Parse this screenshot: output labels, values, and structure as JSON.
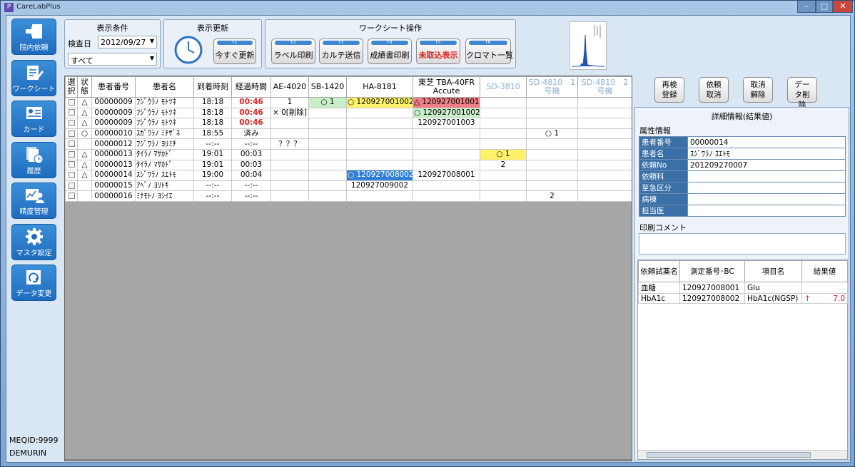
{
  "window": {
    "title": "CareLabPlus",
    "app_icon": "P"
  },
  "sidebar": {
    "items": [
      {
        "label": "院内依頼",
        "icon": "enter-icon"
      },
      {
        "label": "ワークシート",
        "icon": "worksheet-icon"
      },
      {
        "label": "カード",
        "icon": "card-icon"
      },
      {
        "label": "履歴",
        "icon": "history-icon"
      },
      {
        "label": "精度管理",
        "icon": "qc-icon"
      },
      {
        "label": "マスタ設定",
        "icon": "gear-icon"
      },
      {
        "label": "データ変更",
        "icon": "data-change-icon"
      }
    ],
    "meqid": "MEQID:9999",
    "user": "DEMURIN"
  },
  "display_cond": {
    "title": "表示条件",
    "date_label": "検査日",
    "date_value": "2012/09/27",
    "filter_value": "すべて"
  },
  "refresh": {
    "title": "表示更新",
    "f1_key": "F1",
    "f1_label": "今すぐ更新"
  },
  "worksheet_ops": {
    "title": "ワークシート操作",
    "buttons": [
      {
        "key": "F2",
        "label": "ラベル印刷"
      },
      {
        "key": "F3",
        "label": "カルテ送信"
      },
      {
        "key": "F4",
        "label": "成績書印刷"
      },
      {
        "key": "F5",
        "label": "未取込表示"
      },
      {
        "key": "F6",
        "label": "クロマト一覧"
      }
    ]
  },
  "grid": {
    "headers": [
      "選択",
      "状態",
      "患者番号",
      "患者名",
      "到着時刻",
      "経過時間",
      "AE-4020",
      "SB-1420",
      "HA-8181",
      "東芝 TBA-40FR Accute",
      "SD-3810",
      "SD-4810　1号機",
      "SD-4810　2号機"
    ],
    "rows": [
      [
        "",
        "△",
        "00000009",
        "ﾌｼﾞｳﾗﾉ ﾓﾄﾂﾈ",
        "18:18",
        "00:46",
        "1",
        "○ 1",
        "○ 120927001002",
        "△ 120927001001",
        "",
        "",
        ""
      ],
      [
        "",
        "△",
        "00000009",
        "ﾌｼﾞｳﾗﾉ ﾓﾄﾂﾈ",
        "18:18",
        "00:46",
        "× 0[削除]",
        "",
        "",
        "○ 120927001002",
        "",
        "",
        ""
      ],
      [
        "",
        "△",
        "00000009",
        "ﾌｼﾞｳﾗﾉ ﾓﾄﾂﾈ",
        "18:18",
        "00:46",
        "",
        "",
        "",
        "120927001003",
        "",
        "",
        ""
      ],
      [
        "",
        "○",
        "00000010",
        "ｽｶﾞﾜﾗﾉ ﾐﾁｻﾞﾈ",
        "18:55",
        "済み",
        "",
        "",
        "",
        "",
        "",
        "○ 1",
        ""
      ],
      [
        "",
        "",
        "00000012",
        "ﾌｼﾞﾜﾗﾉ ﾖﾘﾐﾁ",
        "--:--",
        "--:--",
        "？？？",
        "",
        "",
        "",
        "",
        "",
        ""
      ],
      [
        "",
        "△",
        "00000013",
        "ﾀｲﾗﾉ ﾏｻｶﾄﾞ",
        "19:01",
        "00:03",
        "",
        "",
        "",
        "",
        "○ 1",
        "",
        ""
      ],
      [
        "",
        "△",
        "00000013",
        "ﾀｲﾗﾉ ﾏｻｶﾄﾞ",
        "19:01",
        "00:03",
        "",
        "",
        "",
        "",
        "2",
        "",
        ""
      ],
      [
        "",
        "△",
        "00000014",
        "ｽｼﾞﾜﾗﾉ ｽｴﾄﾓ",
        "19:00",
        "00:04",
        "",
        "",
        "○ 120927008002",
        "120927008001",
        "",
        "",
        ""
      ],
      [
        "",
        "",
        "00000015",
        "ｱﾍﾞﾉ ﾖﾘﾄｷ",
        "--:--",
        "--:--",
        "",
        "",
        "120927009002",
        "",
        "",
        "",
        ""
      ],
      [
        "",
        "",
        "00000016",
        "ﾐﾅﾓﾄﾉ ﾖｼｲｴ",
        "--:--",
        "--:--",
        "",
        "",
        "",
        "",
        "",
        "2",
        ""
      ]
    ]
  },
  "side_buttons": [
    "再検登録",
    "依頼取消",
    "取消解除",
    "データ削除"
  ],
  "detail": {
    "title": "詳細情報(結果値)",
    "attr_title": "属性情報",
    "attrs": [
      [
        "患者番号",
        "00000014"
      ],
      [
        "患者名",
        "ｽｼﾞﾜﾗﾉ ｽｴﾄﾓ"
      ],
      [
        "依頼No",
        "201209270007"
      ],
      [
        "依頼科",
        ""
      ],
      [
        "至急区分",
        ""
      ],
      [
        "病棟",
        ""
      ],
      [
        "担当医",
        ""
      ]
    ],
    "comment_label": "印刷コメント",
    "result_headers": [
      "依頼試薬名",
      "測定番号･BC",
      "項目名",
      "結果値"
    ],
    "results": [
      [
        "血糖",
        "120927008001",
        "Glu",
        ""
      ],
      [
        "HbA1c",
        "120927008002",
        "HbA1c(NGSP)",
        "7.0"
      ]
    ]
  }
}
